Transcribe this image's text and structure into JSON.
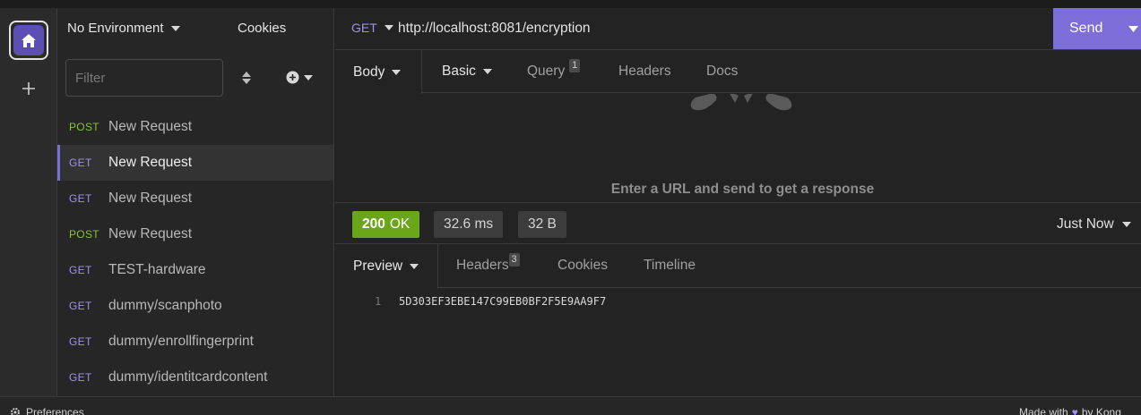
{
  "sidebar": {
    "environment_label": "No Environment",
    "cookies_label": "Cookies",
    "filter_placeholder": "Filter",
    "requests": [
      {
        "method": "POST",
        "name": "New Request"
      },
      {
        "method": "GET",
        "name": "New Request"
      },
      {
        "method": "GET",
        "name": "New Request"
      },
      {
        "method": "POST",
        "name": "New Request"
      },
      {
        "method": "GET",
        "name": "TEST-hardware"
      },
      {
        "method": "GET",
        "name": "dummy/scanphoto"
      },
      {
        "method": "GET",
        "name": "dummy/enrollfingerprint"
      },
      {
        "method": "GET",
        "name": "dummy/identitcardcontent"
      }
    ]
  },
  "request": {
    "method": "GET",
    "url": "http://localhost:8081/encryption",
    "send_label": "Send",
    "tabs": {
      "body": "Body",
      "auth": "Basic",
      "query": "Query",
      "query_count": "1",
      "headers": "Headers",
      "docs": "Docs"
    },
    "hint": "Enter a URL and send to get a response"
  },
  "response": {
    "status_code": "200",
    "status_text": "OK",
    "time": "32.6 ms",
    "size": "32 B",
    "history": "Just Now",
    "tabs": {
      "preview": "Preview",
      "headers": "Headers",
      "headers_count": "3",
      "cookies": "Cookies",
      "timeline": "Timeline"
    },
    "line_number": "1",
    "body": "5D303EF3EBE147C99EB0BF2F5E9AA9F7"
  },
  "footer": {
    "preferences": "Preferences",
    "made_with": "Made with",
    "by": "by Kong"
  },
  "colors": {
    "accent": "#7d6fd9",
    "get": "#9d92e8",
    "post": "#86c232",
    "status_ok": "#6ba51a"
  },
  "icons": [
    "home-icon",
    "plus-icon",
    "caret-down-icon",
    "sort-icon",
    "plus-circle-icon",
    "gear-icon",
    "heart-icon",
    "insomnia-mascot-icon"
  ]
}
